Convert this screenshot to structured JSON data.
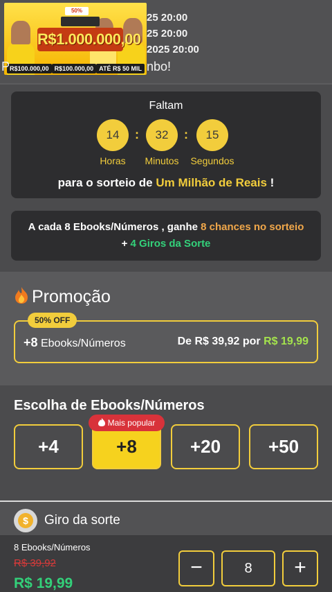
{
  "header": {
    "banner": {
      "discount": "50% OFF",
      "headline": "R$1.000.000,00",
      "prizes": [
        "R$100.000,00",
        "R$100.000,00",
        "ATÉ R$ 50 MIL"
      ]
    },
    "dates": [
      "25 20:00",
      "25 20:00",
      "2025 20:00"
    ],
    "welcome_prefix": "P",
    "welcome_suffix": "nbo!"
  },
  "countdown": {
    "title": "Faltam",
    "hours": "14",
    "minutes": "32",
    "seconds": "15",
    "hours_label": "Horas",
    "minutes_label": "Minutos",
    "seconds_label": "Segundos",
    "draw_prefix": "para o sorteio de ",
    "draw_highlight": "Um Milhão de Reais",
    "draw_suffix": " !"
  },
  "info": {
    "part1": "A cada 8 Ebooks/Números , ganhe ",
    "highlight1": "8 chances no sorteio",
    "part2": " + ",
    "highlight2": "4 Giros da Sorte"
  },
  "promo": {
    "title": "Promoção",
    "badge": "50% OFF",
    "qty": "+8",
    "unit": "Ebooks/Números",
    "price_prefix": "De R$ 39,92 por ",
    "price_new": "R$ 19,99"
  },
  "choose": {
    "title": "Escolha de Ebooks/Números",
    "popular_label": "Mais popular",
    "options": [
      "+4",
      "+8",
      "+20",
      "+50"
    ],
    "selected": "+8"
  },
  "giro": {
    "icon_symbol": "$",
    "title": "Giro da sorte"
  },
  "cart": {
    "label": "8 Ebooks/Números",
    "old_price": "R$ 39,92",
    "new_price": "R$ 19,99",
    "quantity": "8",
    "minus": "−",
    "plus": "+"
  },
  "colors": {
    "accent": "#f2cd3c",
    "green": "#33d17a",
    "red": "#d8323a"
  }
}
